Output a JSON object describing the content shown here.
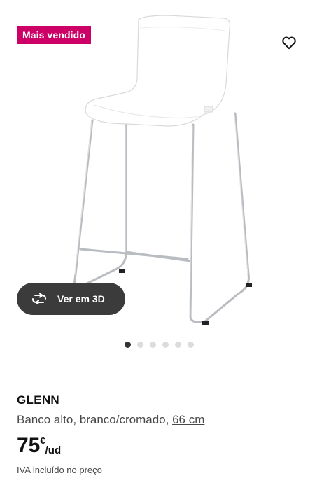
{
  "badge": {
    "label": "Mais vendido"
  },
  "favorite": {
    "icon": "heart-icon"
  },
  "viewer": {
    "label": "Ver em 3D",
    "icon": "rotate-3d-icon"
  },
  "carousel": {
    "count": 6,
    "active_index": 0
  },
  "product": {
    "name": "GLENN",
    "description": "Banco alto, branco/cromado,",
    "size": "66 cm",
    "price_integer": "75",
    "price_currency": "€",
    "price_unit": "/ud",
    "vat_note": "IVA incluído no preço"
  },
  "colors": {
    "badge": "#cc0066",
    "viewer_button": "#3b3b3b"
  }
}
